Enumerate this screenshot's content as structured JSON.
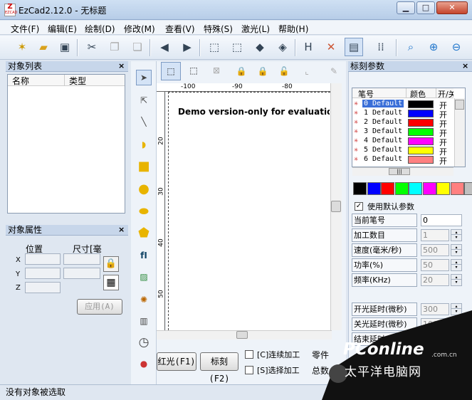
{
  "window": {
    "title": "EzCad2.12.0 - 无标题",
    "icon_text": "EZCAD"
  },
  "menu": [
    "文件(F)",
    "编辑(E)",
    "绘制(D)",
    "修改(M)",
    "查看(V)",
    "特殊(S)",
    "激光(L)",
    "帮助(H)"
  ],
  "object_list": {
    "title": "对象列表",
    "col_name": "名称",
    "col_type": "类型"
  },
  "object_props": {
    "title": "对象属性",
    "position": "位置",
    "size": "尺寸[毫",
    "x": "X",
    "y": "Y",
    "z": "Z",
    "apply": "应用(A)"
  },
  "canvas": {
    "demo_text": "Demo version-only for evaluation",
    "h_ticks": [
      "-100",
      "-90",
      "-80"
    ],
    "v_ticks": [
      "20",
      "30",
      "40",
      "50"
    ]
  },
  "bottom": {
    "red_light": "红光(F1)",
    "mark": "标刻(F2)",
    "continuous": "[C]连续加工",
    "select_proc": "[S]选择加工",
    "parts": "零件",
    "total": "总数"
  },
  "mark_params": {
    "title": "标刻参数",
    "col_pen": "笔号",
    "col_color": "颜色",
    "col_on": "开/关",
    "pens": [
      {
        "label": "0 Default",
        "color": "#000000",
        "on": "开",
        "selected": true
      },
      {
        "label": "1 Default",
        "color": "#0000ff",
        "on": "开",
        "selected": false
      },
      {
        "label": "2 Default",
        "color": "#ff0000",
        "on": "开",
        "selected": false
      },
      {
        "label": "3 Default",
        "color": "#00ff00",
        "on": "开",
        "selected": false
      },
      {
        "label": "4 Default",
        "color": "#ff00ff",
        "on": "开",
        "selected": false
      },
      {
        "label": "5 Default",
        "color": "#ffff00",
        "on": "开",
        "selected": false
      },
      {
        "label": "6 Default",
        "color": "#ff8080",
        "on": "开",
        "selected": false
      }
    ],
    "palette": [
      "#000000",
      "#0000ff",
      "#ff0000",
      "#00ff00",
      "#00ffff",
      "#ff00ff",
      "#ffff00",
      "#ff8080",
      "#c0c0c0"
    ],
    "use_default": "使用默认参数",
    "params": [
      {
        "label": "当前笔号",
        "value": "0"
      },
      {
        "label": "加工数目",
        "value": "1"
      },
      {
        "label": "速度(毫米/秒)",
        "value": "500"
      },
      {
        "label": "功率(%)",
        "value": "50"
      },
      {
        "label": "频率(KHz)",
        "value": "20"
      }
    ],
    "delays": [
      {
        "label": "开光延时(微秒)",
        "value": "300"
      },
      {
        "label": "关光延时(微秒)",
        "value": "100"
      },
      {
        "label": "结束延时(微秒)",
        "value": ""
      }
    ]
  },
  "status": "没有对象被选取",
  "watermark": {
    "brand": "PConline",
    "domain": ".com.cn",
    "cn": "太平洋电脑网"
  }
}
